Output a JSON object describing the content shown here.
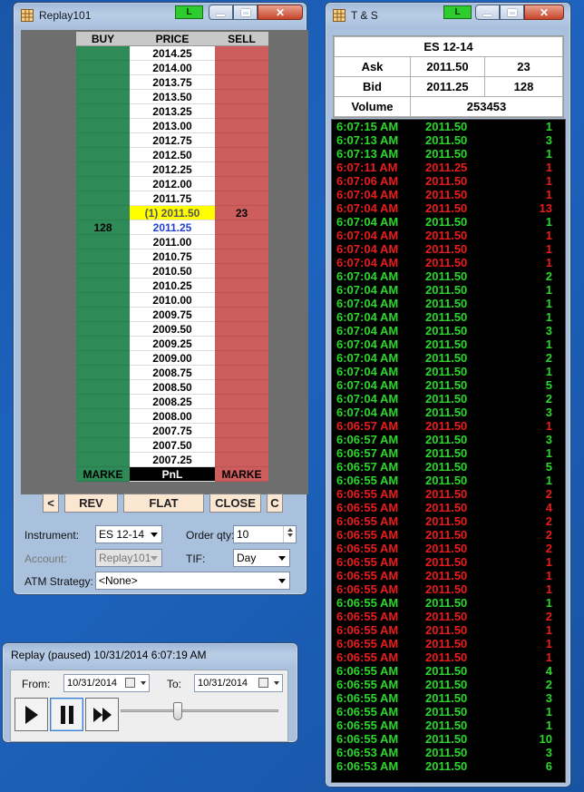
{
  "dom_window": {
    "title": "Replay101",
    "status_button": "L",
    "headers": {
      "buy": "BUY",
      "price": "PRICE",
      "sell": "SELL"
    },
    "ladder": [
      {
        "buy": "",
        "price": "2014.25",
        "sell": ""
      },
      {
        "buy": "",
        "price": "2014.00",
        "sell": ""
      },
      {
        "buy": "",
        "price": "2013.75",
        "sell": ""
      },
      {
        "buy": "",
        "price": "2013.50",
        "sell": ""
      },
      {
        "buy": "",
        "price": "2013.25",
        "sell": ""
      },
      {
        "buy": "",
        "price": "2013.00",
        "sell": ""
      },
      {
        "buy": "",
        "price": "2012.75",
        "sell": ""
      },
      {
        "buy": "",
        "price": "2012.50",
        "sell": ""
      },
      {
        "buy": "",
        "price": "2012.25",
        "sell": ""
      },
      {
        "buy": "",
        "price": "2012.00",
        "sell": ""
      },
      {
        "buy": "",
        "price": "2011.75",
        "sell": ""
      },
      {
        "buy": "",
        "price": "(1) 2011.50",
        "sell": "23",
        "kind": "ask"
      },
      {
        "buy": "128",
        "price": "2011.25",
        "sell": "",
        "kind": "bid"
      },
      {
        "buy": "",
        "price": "2011.00",
        "sell": ""
      },
      {
        "buy": "",
        "price": "2010.75",
        "sell": ""
      },
      {
        "buy": "",
        "price": "2010.50",
        "sell": ""
      },
      {
        "buy": "",
        "price": "2010.25",
        "sell": ""
      },
      {
        "buy": "",
        "price": "2010.00",
        "sell": ""
      },
      {
        "buy": "",
        "price": "2009.75",
        "sell": ""
      },
      {
        "buy": "",
        "price": "2009.50",
        "sell": ""
      },
      {
        "buy": "",
        "price": "2009.25",
        "sell": ""
      },
      {
        "buy": "",
        "price": "2009.00",
        "sell": ""
      },
      {
        "buy": "",
        "price": "2008.75",
        "sell": ""
      },
      {
        "buy": "",
        "price": "2008.50",
        "sell": ""
      },
      {
        "buy": "",
        "price": "2008.25",
        "sell": ""
      },
      {
        "buy": "",
        "price": "2008.00",
        "sell": ""
      },
      {
        "buy": "",
        "price": "2007.75",
        "sell": ""
      },
      {
        "buy": "",
        "price": "2007.50",
        "sell": ""
      },
      {
        "buy": "",
        "price": "2007.25",
        "sell": ""
      }
    ],
    "footer": {
      "buy_market": "MARKE",
      "pnl": "PnL",
      "sell_market": "MARKE"
    },
    "buttons": {
      "left": "<",
      "rev": "REV",
      "flat": "FLAT",
      "close": "CLOSE",
      "c": "C"
    },
    "form": {
      "instrument_label": "Instrument:",
      "instrument_value": "ES 12-14",
      "order_qty_label": "Order qty:",
      "order_qty_value": "10",
      "account_label": "Account:",
      "account_value": "Replay101",
      "tif_label": "TIF:",
      "tif_value": "Day",
      "atm_label": "ATM Strategy:",
      "atm_value": "<None>"
    }
  },
  "ts_window": {
    "title": "T & S",
    "status_button": "L",
    "instrument": "ES 12-14",
    "ask_label": "Ask",
    "ask_price": "2011.50",
    "ask_size": "23",
    "bid_label": "Bid",
    "bid_price": "2011.25",
    "bid_size": "128",
    "volume_label": "Volume",
    "volume_value": "253453",
    "trades": [
      {
        "time": "6:07:15 AM",
        "price": "2011.50",
        "qty": "1",
        "side": "g"
      },
      {
        "time": "6:07:13 AM",
        "price": "2011.50",
        "qty": "3",
        "side": "g"
      },
      {
        "time": "6:07:13 AM",
        "price": "2011.50",
        "qty": "1",
        "side": "g"
      },
      {
        "time": "6:07:11 AM",
        "price": "2011.25",
        "qty": "1",
        "side": "r"
      },
      {
        "time": "6:07:06 AM",
        "price": "2011.50",
        "qty": "1",
        "side": "r"
      },
      {
        "time": "6:07:04 AM",
        "price": "2011.50",
        "qty": "1",
        "side": "r"
      },
      {
        "time": "6:07:04 AM",
        "price": "2011.50",
        "qty": "13",
        "side": "r"
      },
      {
        "time": "6:07:04 AM",
        "price": "2011.50",
        "qty": "1",
        "side": "g"
      },
      {
        "time": "6:07:04 AM",
        "price": "2011.50",
        "qty": "1",
        "side": "r"
      },
      {
        "time": "6:07:04 AM",
        "price": "2011.50",
        "qty": "1",
        "side": "r"
      },
      {
        "time": "6:07:04 AM",
        "price": "2011.50",
        "qty": "1",
        "side": "r"
      },
      {
        "time": "6:07:04 AM",
        "price": "2011.50",
        "qty": "2",
        "side": "g"
      },
      {
        "time": "6:07:04 AM",
        "price": "2011.50",
        "qty": "1",
        "side": "g"
      },
      {
        "time": "6:07:04 AM",
        "price": "2011.50",
        "qty": "1",
        "side": "g"
      },
      {
        "time": "6:07:04 AM",
        "price": "2011.50",
        "qty": "1",
        "side": "g"
      },
      {
        "time": "6:07:04 AM",
        "price": "2011.50",
        "qty": "3",
        "side": "g"
      },
      {
        "time": "6:07:04 AM",
        "price": "2011.50",
        "qty": "1",
        "side": "g"
      },
      {
        "time": "6:07:04 AM",
        "price": "2011.50",
        "qty": "2",
        "side": "g"
      },
      {
        "time": "6:07:04 AM",
        "price": "2011.50",
        "qty": "1",
        "side": "g"
      },
      {
        "time": "6:07:04 AM",
        "price": "2011.50",
        "qty": "5",
        "side": "g"
      },
      {
        "time": "6:07:04 AM",
        "price": "2011.50",
        "qty": "2",
        "side": "g"
      },
      {
        "time": "6:07:04 AM",
        "price": "2011.50",
        "qty": "3",
        "side": "g"
      },
      {
        "time": "6:06:57 AM",
        "price": "2011.50",
        "qty": "1",
        "side": "r"
      },
      {
        "time": "6:06:57 AM",
        "price": "2011.50",
        "qty": "3",
        "side": "g"
      },
      {
        "time": "6:06:57 AM",
        "price": "2011.50",
        "qty": "1",
        "side": "g"
      },
      {
        "time": "6:06:57 AM",
        "price": "2011.50",
        "qty": "5",
        "side": "g"
      },
      {
        "time": "6:06:55 AM",
        "price": "2011.50",
        "qty": "1",
        "side": "g"
      },
      {
        "time": "6:06:55 AM",
        "price": "2011.50",
        "qty": "2",
        "side": "r"
      },
      {
        "time": "6:06:55 AM",
        "price": "2011.50",
        "qty": "4",
        "side": "r"
      },
      {
        "time": "6:06:55 AM",
        "price": "2011.50",
        "qty": "2",
        "side": "r"
      },
      {
        "time": "6:06:55 AM",
        "price": "2011.50",
        "qty": "2",
        "side": "r"
      },
      {
        "time": "6:06:55 AM",
        "price": "2011.50",
        "qty": "2",
        "side": "r"
      },
      {
        "time": "6:06:55 AM",
        "price": "2011.50",
        "qty": "1",
        "side": "r"
      },
      {
        "time": "6:06:55 AM",
        "price": "2011.50",
        "qty": "1",
        "side": "r"
      },
      {
        "time": "6:06:55 AM",
        "price": "2011.50",
        "qty": "1",
        "side": "r"
      },
      {
        "time": "6:06:55 AM",
        "price": "2011.50",
        "qty": "1",
        "side": "g"
      },
      {
        "time": "6:06:55 AM",
        "price": "2011.50",
        "qty": "2",
        "side": "r"
      },
      {
        "time": "6:06:55 AM",
        "price": "2011.50",
        "qty": "1",
        "side": "r"
      },
      {
        "time": "6:06:55 AM",
        "price": "2011.50",
        "qty": "1",
        "side": "r"
      },
      {
        "time": "6:06:55 AM",
        "price": "2011.50",
        "qty": "1",
        "side": "r"
      },
      {
        "time": "6:06:55 AM",
        "price": "2011.50",
        "qty": "4",
        "side": "g"
      },
      {
        "time": "6:06:55 AM",
        "price": "2011.50",
        "qty": "2",
        "side": "g"
      },
      {
        "time": "6:06:55 AM",
        "price": "2011.50",
        "qty": "3",
        "side": "g"
      },
      {
        "time": "6:06:55 AM",
        "price": "2011.50",
        "qty": "1",
        "side": "g"
      },
      {
        "time": "6:06:55 AM",
        "price": "2011.50",
        "qty": "1",
        "side": "g"
      },
      {
        "time": "6:06:55 AM",
        "price": "2011.50",
        "qty": "10",
        "side": "g"
      },
      {
        "time": "6:06:53 AM",
        "price": "2011.50",
        "qty": "3",
        "side": "g"
      },
      {
        "time": "6:06:53 AM",
        "price": "2011.50",
        "qty": "6",
        "side": "g"
      }
    ]
  },
  "replay_window": {
    "title": "Replay (paused) 10/31/2014 6:07:19 AM",
    "from_label": "From:",
    "from_value": "10/31/2014",
    "to_label": "To:",
    "to_value": "10/31/2014",
    "speed_position": 0.36
  },
  "colors": {
    "buy_cell": "#2e8b57",
    "sell_cell": "#cd5c5c",
    "ask_highlight": "#ffff00",
    "bid_text": "#1f3fd6",
    "trade_up": "#2bd82b",
    "trade_down": "#ea1c1c"
  }
}
